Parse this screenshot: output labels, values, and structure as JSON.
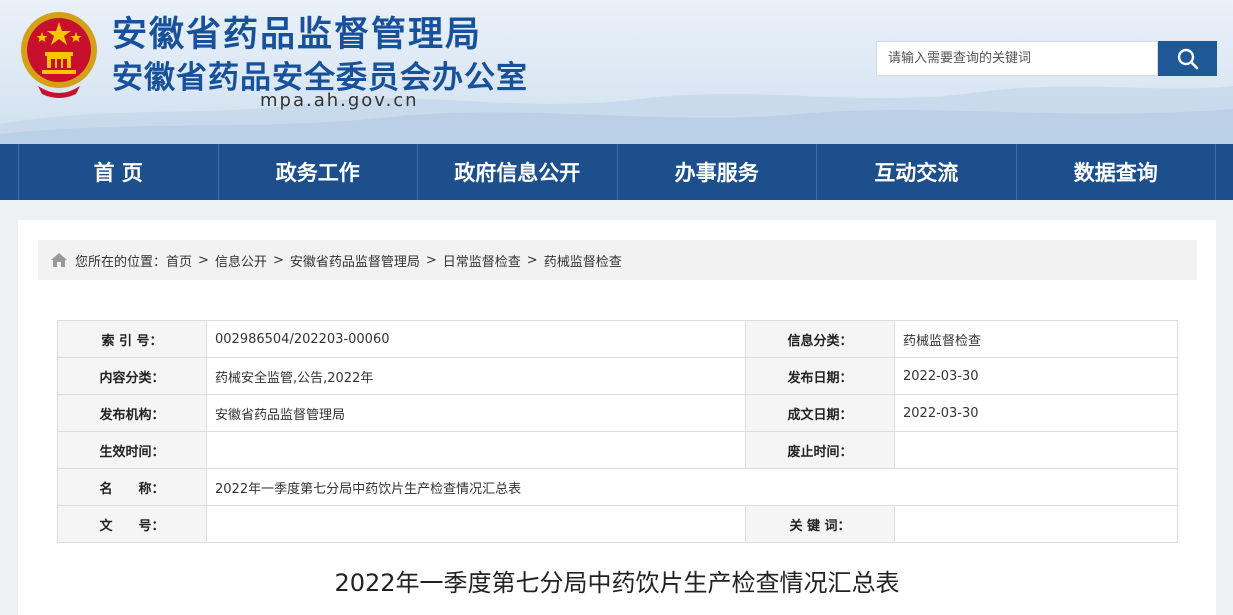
{
  "header": {
    "title_main": "安徽省药品监督管理局",
    "title_sub": "安徽省药品安全委员会办公室",
    "domain": "mpa.ah.gov.cn",
    "emblem_icon": "national-emblem-icon"
  },
  "search": {
    "placeholder": "请输入需要查询的关键词",
    "button_icon": "search-icon"
  },
  "nav": {
    "items": [
      "首 页",
      "政务工作",
      "政府信息公开",
      "办事服务",
      "互动交流",
      "数据查询"
    ]
  },
  "breadcrumb": {
    "prefix": "您所在的位置：",
    "items": [
      "首页",
      "信息公开",
      "安徽省药品监督管理局",
      "日常监督检查",
      "药械监督检查"
    ],
    "separator": ">"
  },
  "info_table": {
    "index_label": "索 引 号：",
    "index_value": "002986504/202203-00060",
    "category_label": "信息分类：",
    "category_value": "药械监督检查",
    "content_label": "内容分类：",
    "content_value": "药械安全监管,公告,2022年",
    "publish_date_label": "发布日期：",
    "publish_date_value": "2022-03-30",
    "publisher_label": "发布机构：",
    "publisher_value": "安徽省药品监督管理局",
    "created_date_label": "成文日期：",
    "created_date_value": "2022-03-30",
    "effective_label": "生效时间：",
    "effective_value": "",
    "abolish_label": "废止时间：",
    "abolish_value": "",
    "name_label": "名　　称：",
    "name_value": "2022年一季度第七分局中药饮片生产检查情况汇总表",
    "doc_no_label": "文　　号：",
    "doc_no_value": "",
    "keywords_label": "关 键 词：",
    "keywords_value": ""
  },
  "article": {
    "title": "2022年一季度第七分局中药饮片生产检查情况汇总表"
  },
  "colors": {
    "brand_blue": "#17519b",
    "nav_blue": "#1c4f8c",
    "search_btn": "#1f5896"
  }
}
